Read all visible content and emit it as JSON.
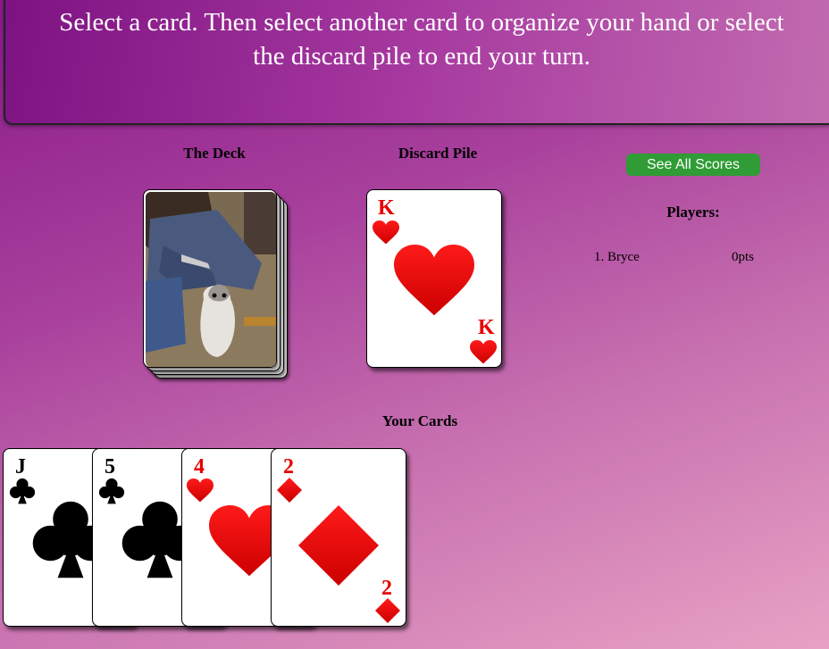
{
  "banner": {
    "line1": "Select a card. Then select another card to organize your hand or select",
    "line2": "the discard pile to end your turn."
  },
  "deck": {
    "label": "The Deck"
  },
  "discard": {
    "label": "Discard Pile",
    "card": {
      "rank": "K",
      "suit": "hearts"
    }
  },
  "scores_button": "See All Scores",
  "players": {
    "heading": "Players:",
    "list": [
      {
        "name": "1. Bryce",
        "score": "0pts"
      }
    ]
  },
  "hand": {
    "label": "Your Cards",
    "cards": [
      {
        "rank": "J",
        "suit": "clubs"
      },
      {
        "rank": "5",
        "suit": "clubs"
      },
      {
        "rank": "4",
        "suit": "hearts"
      },
      {
        "rank": "2",
        "suit": "diamonds"
      }
    ]
  },
  "colors": {
    "red_suit": "#e60000",
    "button": "#2f9c35"
  }
}
